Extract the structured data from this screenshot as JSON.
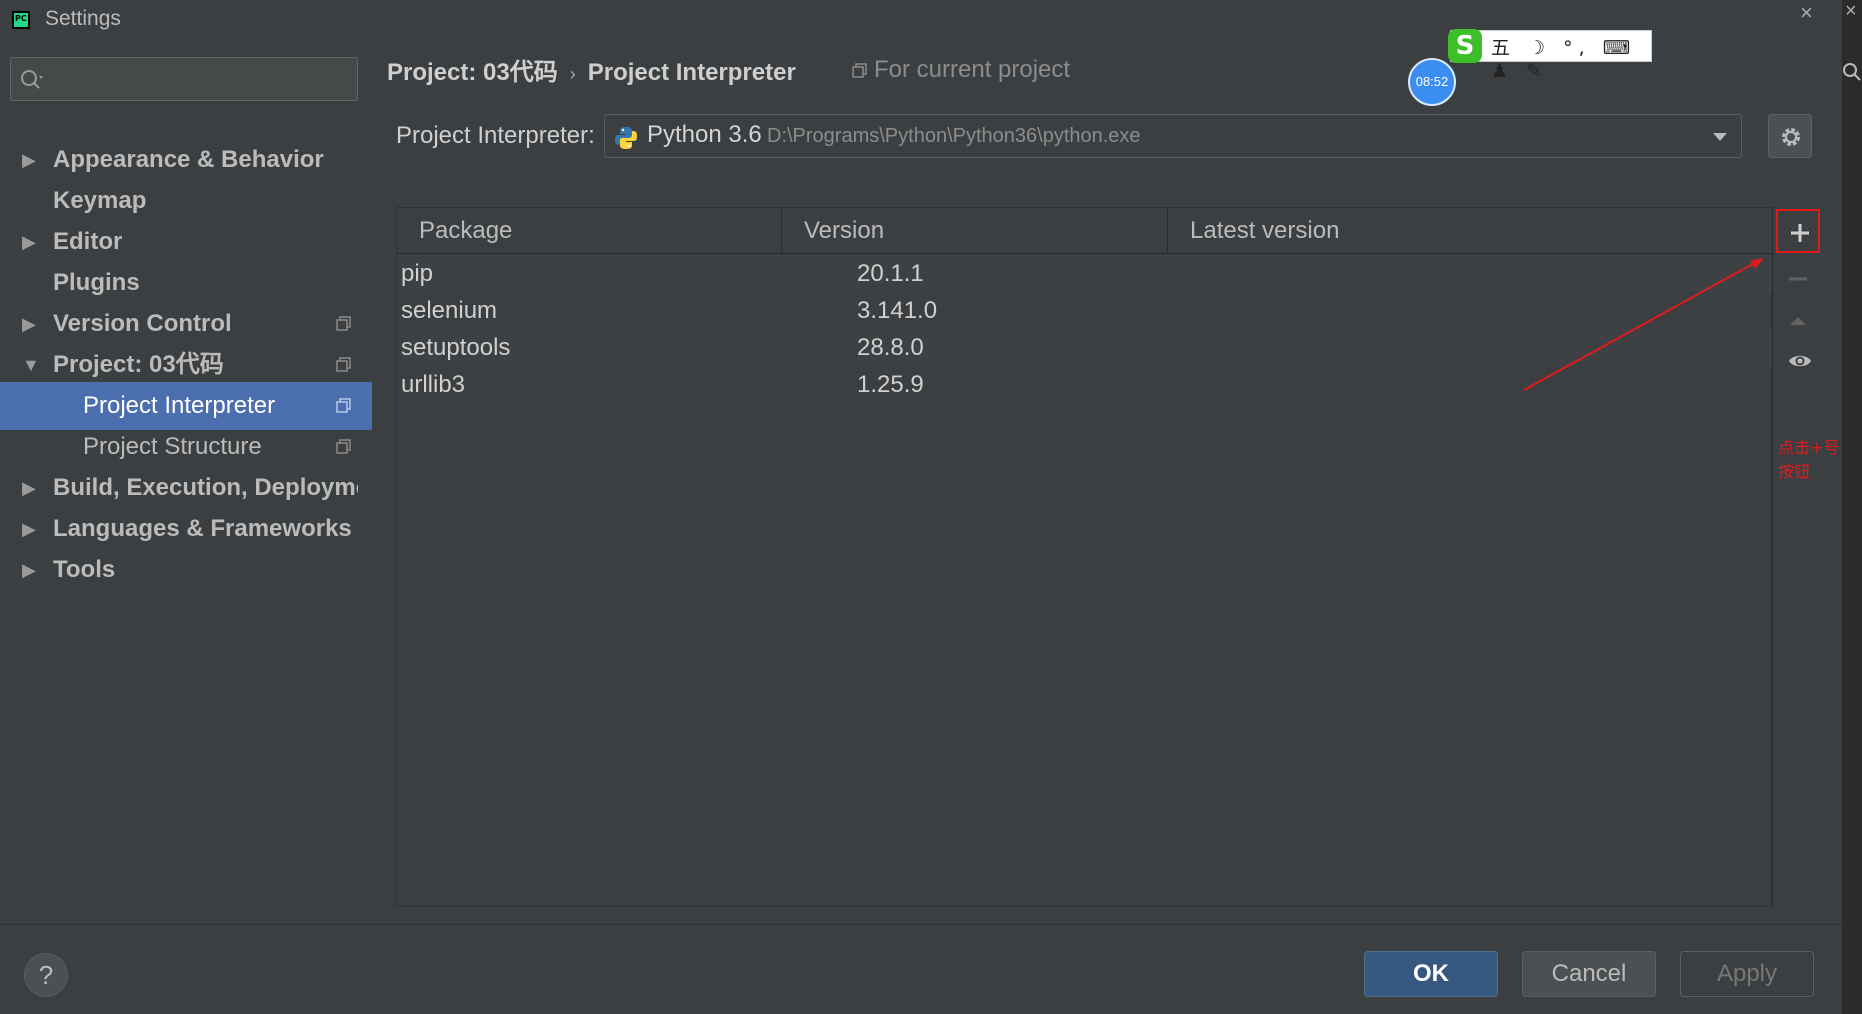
{
  "window": {
    "title": "Settings",
    "close_glyph": "×"
  },
  "sidebar": {
    "search_placeholder": "",
    "items": [
      {
        "label": "Appearance & Behavior",
        "bold": true,
        "arrow": "▶"
      },
      {
        "label": "Keymap",
        "bold": true
      },
      {
        "label": "Editor",
        "bold": true,
        "arrow": "▶"
      },
      {
        "label": "Plugins",
        "bold": true
      },
      {
        "label": "Version Control",
        "bold": true,
        "arrow": "▶",
        "icon": "copy-icon"
      },
      {
        "label": "Project: 03代码",
        "bold": true,
        "arrow": "▼",
        "icon": "copy-icon"
      },
      {
        "label": "Project Interpreter",
        "selected": true,
        "icon": "copy-icon"
      },
      {
        "label": "Project Structure",
        "icon": "copy-icon"
      },
      {
        "label": "Build, Execution, Deployment",
        "bold": true,
        "arrow": "▶"
      },
      {
        "label": "Languages & Frameworks",
        "bold": true,
        "arrow": "▶"
      },
      {
        "label": "Tools",
        "bold": true,
        "arrow": "▶"
      }
    ]
  },
  "main": {
    "breadcrumb": {
      "project": "Project: 03代码",
      "separator": "›",
      "page": "Project Interpreter"
    },
    "for_current_project": "For current project",
    "interpreter": {
      "label": "Project Interpreter:",
      "name": "Python 3.6",
      "path": "D:\\Programs\\Python\\Python36\\python.exe"
    },
    "table": {
      "columns": [
        "Package",
        "Version",
        "Latest version"
      ],
      "rows": [
        {
          "package": "pip",
          "version": "20.1.1",
          "latest": ""
        },
        {
          "package": "selenium",
          "version": "3.141.0",
          "latest": ""
        },
        {
          "package": "setuptools",
          "version": "28.8.0",
          "latest": ""
        },
        {
          "package": "urllib3",
          "version": "1.25.9",
          "latest": ""
        }
      ]
    },
    "toolbar": {
      "add": "+",
      "remove": "−"
    },
    "annotation": "点击+号按钮"
  },
  "overlay": {
    "ime_logo": "S",
    "ime_items": "五 ☽ °, ⌨ ♟ ✎",
    "clock": "08:52"
  },
  "footer": {
    "help": "?",
    "ok": "OK",
    "cancel": "Cancel",
    "apply": "Apply"
  },
  "colors": {
    "background": "#3c3f41",
    "selection": "#4b6eaf",
    "ok_button": "#365880",
    "annotation": "#e01b1b"
  }
}
